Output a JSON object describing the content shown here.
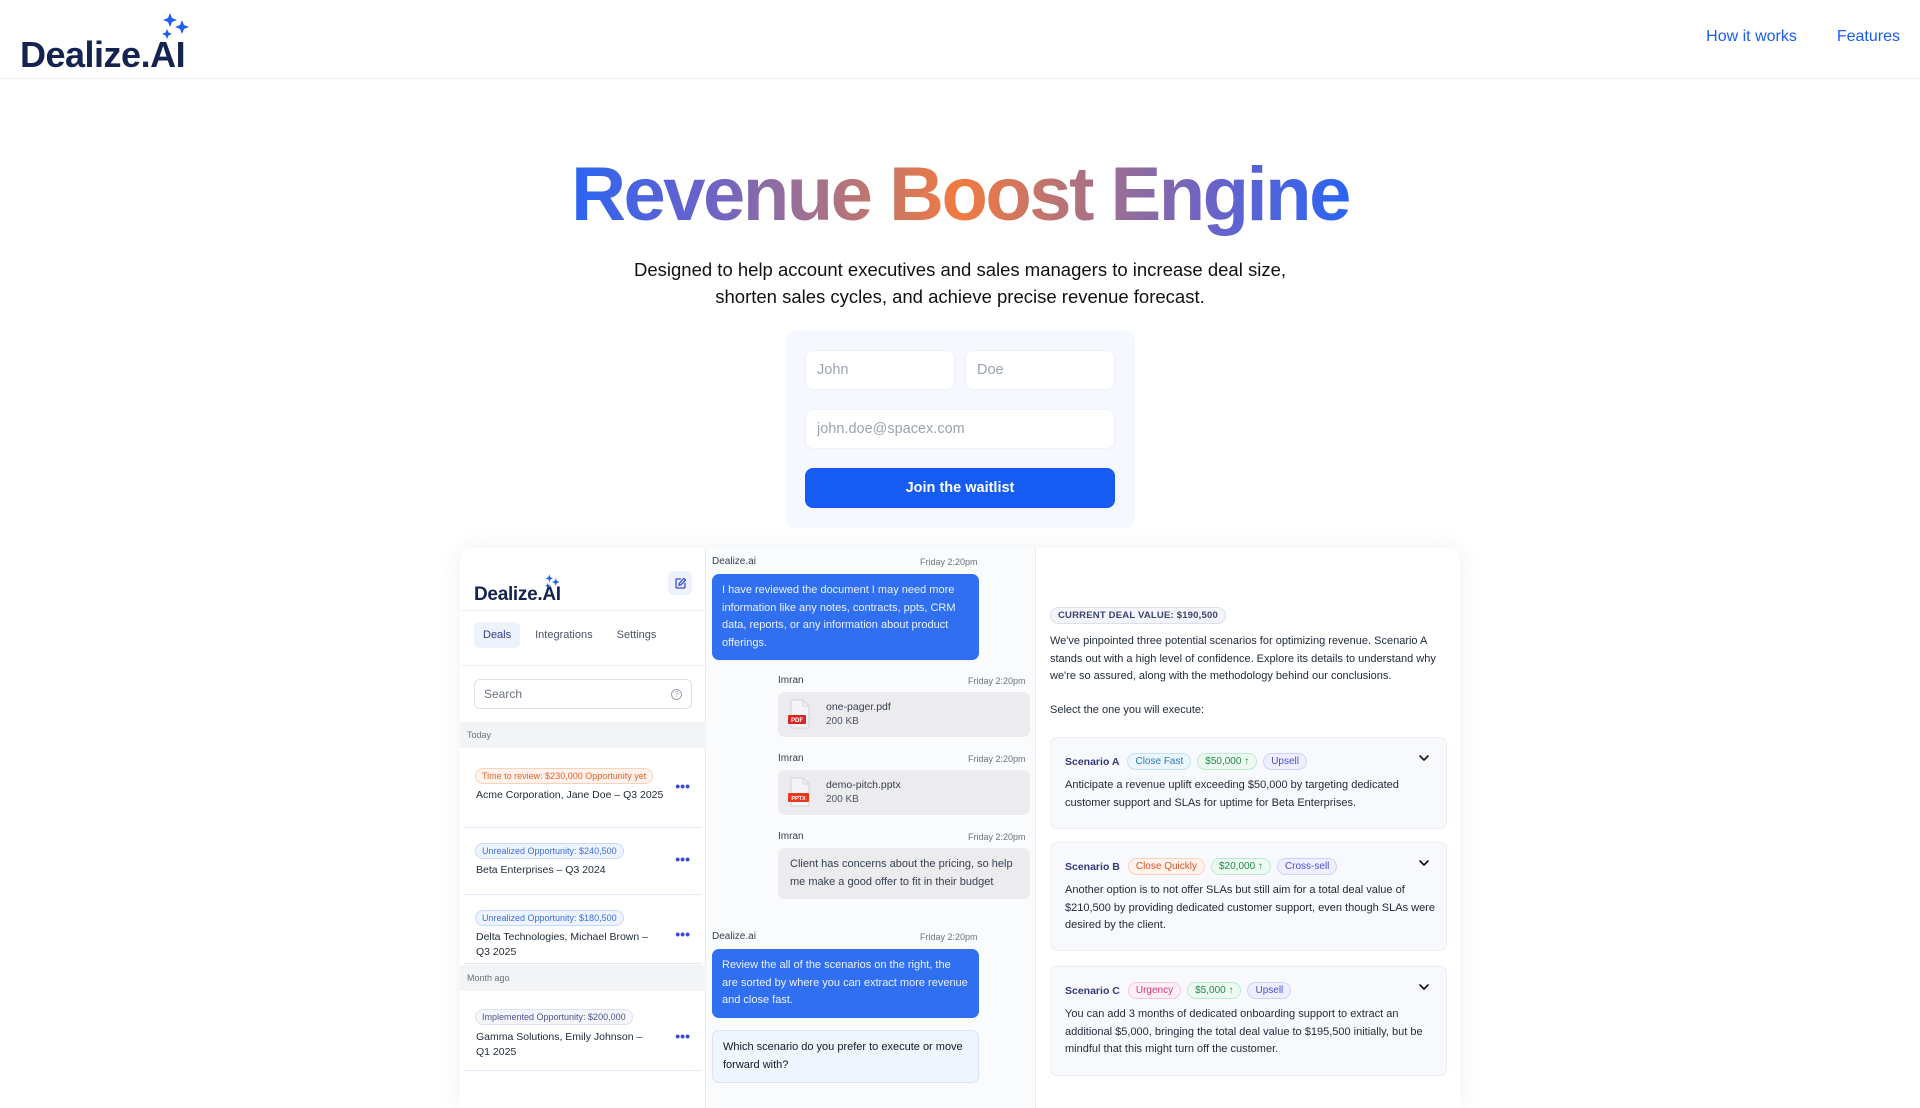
{
  "header": {
    "brand": "Dealize",
    "brand_suffix": ".AI",
    "nav": [
      {
        "label": "How it works"
      },
      {
        "label": "Features"
      }
    ]
  },
  "hero": {
    "title_words": [
      "Revenue",
      "Boost",
      "Engine"
    ],
    "subtitle_line1": "Designed to help account executives and sales managers to increase deal size,",
    "subtitle_line2": "shorten sales cycles, and achieve precise revenue forecast.",
    "gradient_colors": [
      "#2a64f4",
      "#f27b3f",
      "#2a64f4"
    ]
  },
  "form": {
    "first_name_placeholder": "John",
    "last_name_placeholder": "Doe",
    "email_placeholder": "john.doe@spacex.com",
    "submit_label": "Join the waitlist",
    "accent": "#165cf2"
  },
  "app": {
    "sidebar": {
      "brand": "Dealize",
      "brand_suffix": ".AI",
      "tabs": [
        {
          "label": "Deals",
          "active": true
        },
        {
          "label": "Integrations",
          "active": false
        },
        {
          "label": "Settings",
          "active": false
        }
      ],
      "search_placeholder": "Search",
      "help_glyph": "?",
      "sections": [
        {
          "label": "Today"
        },
        {
          "label": "Month ago"
        }
      ],
      "deals": [
        {
          "badge": "Time to review: $230,000 Opportunity yet",
          "title": "Acme Corporation, Jane Doe – Q3 2025",
          "badge_type": "orange"
        },
        {
          "badge": "Unrealized Opportunity: $240,500",
          "title": "Beta Enterprises – Q3 2024",
          "badge_type": "blue"
        },
        {
          "badge": "Unrealized Opportunity: $180,500",
          "title": "Delta Technologies, Michael Brown – Q3 2025",
          "badge_type": "blue"
        },
        {
          "badge": "Implemented Opportunity: $200,000",
          "title": "Gamma Solutions, Emily Johnson – Q1 2025",
          "badge_type": "gray"
        }
      ],
      "more_glyph": "•••"
    },
    "chat": {
      "messages": [
        {
          "sender": "Dealize.ai",
          "time": "Friday 2:20pm",
          "text": "I have reviewed the document I may need more information like any notes, contracts, ppts, CRM data, reports, or any information about product offerings."
        },
        {
          "sender": "Imran",
          "time": "Friday 2:20pm",
          "file_name": "one-pager.pdf",
          "file_size": "200 KB",
          "file_type": "PDF"
        },
        {
          "sender": "Imran",
          "time": "Friday 2:20pm",
          "file_name": "demo-pitch.pptx",
          "file_size": "200 KB",
          "file_type": "PPTX"
        },
        {
          "sender": "Imran",
          "time": "Friday 2:20pm",
          "text": "Client has  concerns about the pricing, so help me make a good  offer to fit in their budget"
        },
        {
          "sender": "Dealize.ai",
          "time": "Friday 2:20pm",
          "text": "Review the all of the scenarios on the right, the are sorted by where you can extract more revenue and close fast."
        },
        {
          "text": "Which scenario do you prefer to execute or move forward with?"
        }
      ]
    },
    "scenarios_panel": {
      "deal_value": "CURRENT DEAL VALUE: $190,500",
      "intro": "We've pinpointed three potential scenarios for optimizing revenue. Scenario A stands out with a high level of confidence. Explore its details to understand why we're so assured, along with the methodology behind our conclusions.",
      "select_label": "Select the one you will execute:",
      "scenarios": [
        {
          "name": "Scenario A",
          "tags": [
            "Close Fast",
            "$50,000 ↑",
            "Upsell"
          ],
          "description": "Anticipate a revenue uplift exceeding $50,000 by targeting dedicated customer support and SLAs for uptime for Beta Enterprises."
        },
        {
          "name": "Scenario B",
          "tags": [
            "Close Quickly",
            "$20,000 ↑",
            "Cross-sell"
          ],
          "description": "Another option is to not offer SLAs but still aim for a total deal value of $210,500 by providing dedicated customer support, even though SLAs were desired by the client."
        },
        {
          "name": "Scenario C",
          "tags": [
            "Urgency",
            "$5,000 ↑",
            "Upsell"
          ],
          "description": "You can add 3 months of dedicated onboarding support to extract an additional $5,000, bringing the total deal value to $195,500 initially, but be mindful that this might turn off the customer."
        }
      ]
    }
  }
}
